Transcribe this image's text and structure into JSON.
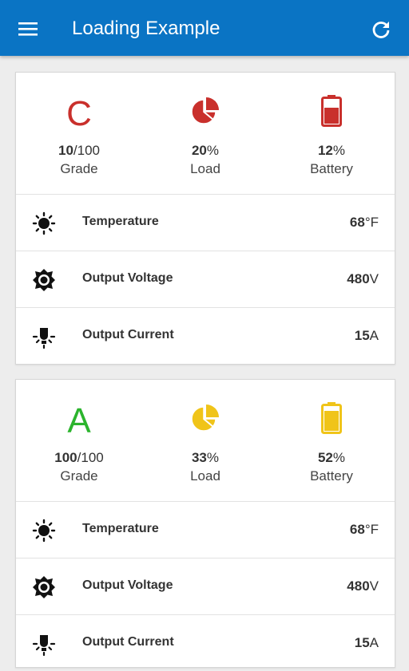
{
  "app": {
    "title": "Loading Example",
    "menu_icon": "menu-icon",
    "refresh_icon": "refresh-icon"
  },
  "colors": {
    "appbar": "#0a74c4",
    "red": "#c9302c",
    "green": "#2bb42d",
    "yellow": "#f0c419"
  },
  "cards": [
    {
      "grade": {
        "letter": "C",
        "value": "10",
        "max": "/100",
        "label": "Grade",
        "color": "#c9302c"
      },
      "load": {
        "value": "20",
        "unit": "%",
        "label": "Load",
        "color": "#c9302c",
        "icon": "pie-chart-icon"
      },
      "battery": {
        "value": "12",
        "unit": "%",
        "label": "Battery",
        "color": "#c9302c",
        "icon": "battery-icon"
      },
      "rows": [
        {
          "label": "Temperature",
          "value": "68",
          "unit": "°F",
          "icon": "sun-icon"
        },
        {
          "label": "Output Voltage",
          "value": "480",
          "unit": "V",
          "icon": "brightness-icon"
        },
        {
          "label": "Output Current",
          "value": "15",
          "unit": "A",
          "icon": "bulb-icon"
        }
      ]
    },
    {
      "grade": {
        "letter": "A",
        "value": "100",
        "max": "/100",
        "label": "Grade",
        "color": "#2bb42d"
      },
      "load": {
        "value": "33",
        "unit": "%",
        "label": "Load",
        "color": "#f0c419",
        "icon": "pie-chart-icon"
      },
      "battery": {
        "value": "52",
        "unit": "%",
        "label": "Battery",
        "color": "#f0c419",
        "icon": "battery-icon"
      },
      "rows": [
        {
          "label": "Temperature",
          "value": "68",
          "unit": "°F",
          "icon": "sun-icon"
        },
        {
          "label": "Output Voltage",
          "value": "480",
          "unit": "V",
          "icon": "brightness-icon"
        },
        {
          "label": "Output Current",
          "value": "15",
          "unit": "A",
          "icon": "bulb-icon"
        }
      ]
    }
  ]
}
